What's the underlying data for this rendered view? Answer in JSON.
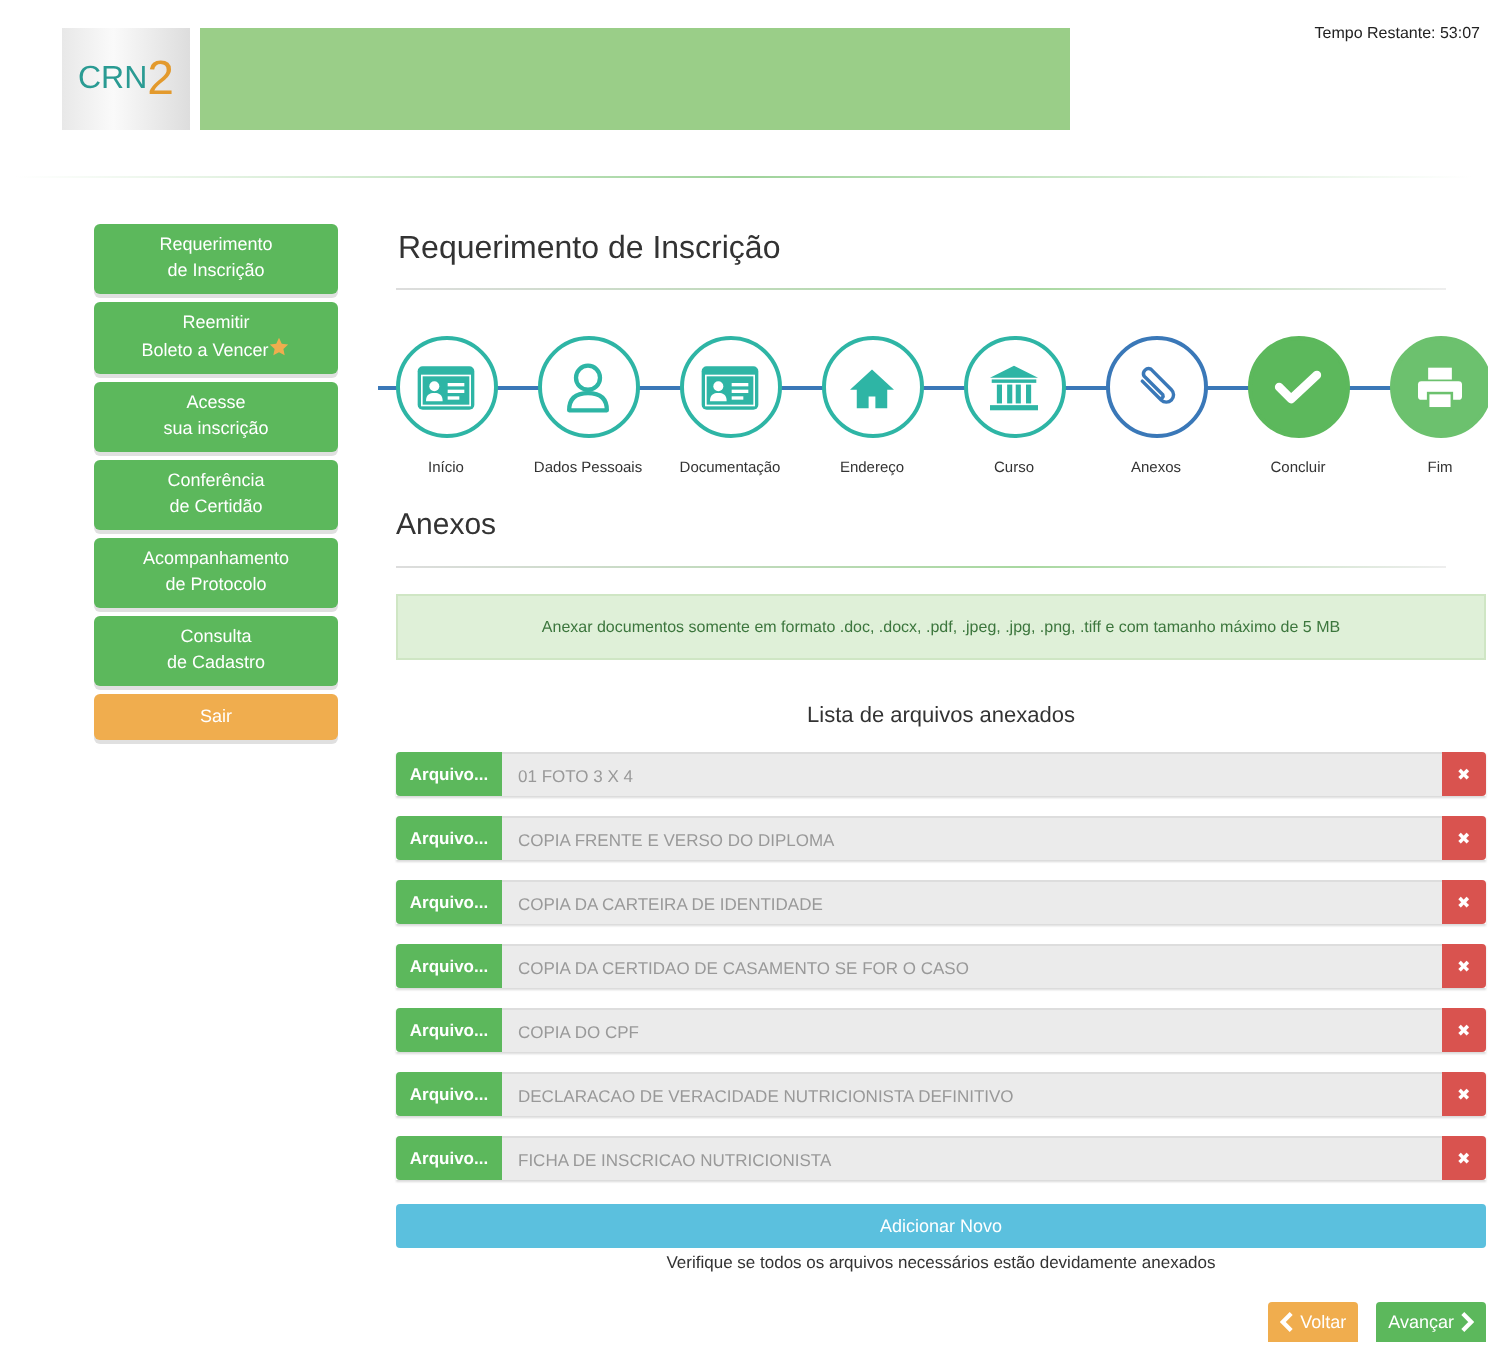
{
  "header": {
    "logo": {
      "letters": "CRN",
      "digit": "2"
    },
    "timer": "Tempo Restante: 53:07"
  },
  "sidebar": {
    "items": [
      {
        "lines": [
          "Requerimento",
          "de Inscrição"
        ],
        "kind": "primary",
        "star": false
      },
      {
        "lines": [
          "Reemitir",
          "Boleto a Vencer"
        ],
        "kind": "primary",
        "star": true
      },
      {
        "lines": [
          "Acesse",
          "sua inscrição"
        ],
        "kind": "primary",
        "star": false
      },
      {
        "lines": [
          "Conferência",
          "de Certidão"
        ],
        "kind": "primary",
        "star": false
      },
      {
        "lines": [
          "Acompanhamento",
          "de Protocolo"
        ],
        "kind": "primary",
        "star": false
      },
      {
        "lines": [
          "Consulta",
          "de Cadastro"
        ],
        "kind": "primary",
        "star": false
      },
      {
        "lines": [
          "Sair"
        ],
        "kind": "warning",
        "star": false
      }
    ]
  },
  "title": "Requerimento de Inscrição",
  "steps": [
    {
      "label": "Início",
      "kind": "done"
    },
    {
      "label": "Dados Pessoais",
      "kind": "done"
    },
    {
      "label": "Documentação",
      "kind": "done"
    },
    {
      "label": "Endereço",
      "kind": "done"
    },
    {
      "label": "Curso",
      "kind": "done"
    },
    {
      "label": "Anexos",
      "kind": "current"
    },
    {
      "label": "Concluir",
      "kind": "action"
    },
    {
      "label": "Fim",
      "kind": "final"
    }
  ],
  "section_title": "Anexos",
  "notice": "Anexar documentos somente em formato .doc, .docx, .pdf, .jpeg, .jpg, .png, .tiff e com tamanho máximo de 5 MB",
  "list_title": "Lista de arquivos anexados",
  "files": [
    {
      "button": "Arquivo...",
      "name": "01 FOTO 3 X 4",
      "remove": "✖"
    },
    {
      "button": "Arquivo...",
      "name": "COPIA FRENTE E VERSO DO DIPLOMA",
      "remove": "✖"
    },
    {
      "button": "Arquivo...",
      "name": "COPIA DA CARTEIRA DE IDENTIDADE",
      "remove": "✖"
    },
    {
      "button": "Arquivo...",
      "name": "COPIA DA CERTIDAO DE CASAMENTO SE FOR O CASO",
      "remove": "✖"
    },
    {
      "button": "Arquivo...",
      "name": "COPIA DO CPF",
      "remove": "✖"
    },
    {
      "button": "Arquivo...",
      "name": "DECLARACAO DE VERACIDADE NUTRICIONISTA DEFINITIVO",
      "remove": "✖"
    },
    {
      "button": "Arquivo...",
      "name": "FICHA DE INSCRICAO NUTRICIONISTA",
      "remove": "✖"
    }
  ],
  "add_button": "Adicionar Novo",
  "hint": "Verifique se todos os arquivos necessários estão devidamente anexados",
  "nav": {
    "back": "Voltar",
    "next": "Avançar"
  }
}
